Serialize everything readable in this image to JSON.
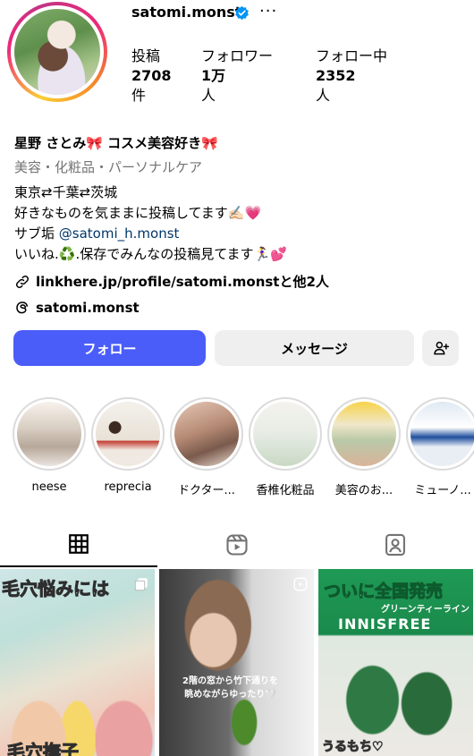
{
  "profile": {
    "username": "satomi.monst",
    "more_label": "···",
    "stats": [
      {
        "label": "投稿",
        "value": "2708",
        "unit": "件"
      },
      {
        "label": "フォロワー",
        "value": "1万",
        "unit": "人"
      },
      {
        "label": "フォロー中",
        "value": "2352",
        "unit": "人"
      }
    ],
    "display_name": "星野 さとみ🎀 コスメ美容好き🎀",
    "category": "美容・化粧品・パーソナルケア",
    "bio": {
      "line1": "東京⇄千葉⇄茨城",
      "line2": "好きなものを気ままに投稿してます✍🏻💗",
      "line3_prefix": "サブ垢 ",
      "line3_mention": "@satomi_h.monst",
      "line4": "いいね.♻️.保存でみんなの投稿見てます🏃‍♀️💕"
    },
    "link": "linkhere.jp/profile/satomi.monstと他2人",
    "threads": "satomi.monst"
  },
  "actions": {
    "follow": "フォロー",
    "message": "メッセージ"
  },
  "highlights": [
    {
      "label": "neese"
    },
    {
      "label": "reprecia"
    },
    {
      "label": "ドクター..."
    },
    {
      "label": "香椎化粧品"
    },
    {
      "label": "美容のお..."
    },
    {
      "label": "ミューノ..."
    }
  ],
  "posts": [
    {
      "caption_top": "毛穴悩みには",
      "caption_bottom": "毛穴撫子"
    },
    {
      "caption_mid": "2階の窓から竹下通りを\n眺めながらゆったり🤍"
    },
    {
      "caption_top": "ついに全国発売",
      "caption_sub": "グリーンティーライン",
      "brand": "innisfree",
      "caption_bottom": "うるもち♡"
    }
  ],
  "colors": {
    "follow_button": "#4a5df9",
    "secondary_button": "#efefef",
    "verified_badge": "#0095f6",
    "mention_link": "#00376b",
    "category_text": "#737373"
  }
}
